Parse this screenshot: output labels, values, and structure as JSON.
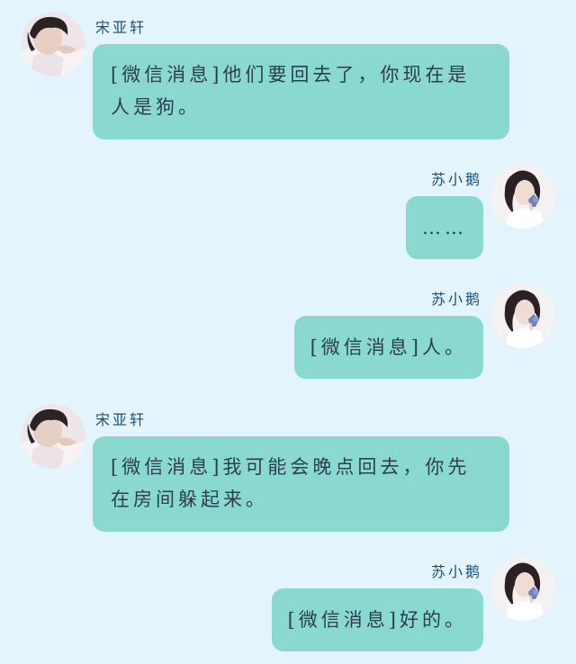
{
  "messages": [
    {
      "side": "left",
      "sender": "宋亚轩",
      "text": "[微信消息]他们要回去了，你现在是人是狗。",
      "avatar": "boy-avatar"
    },
    {
      "side": "right",
      "sender": "苏小鹅",
      "text": "……",
      "avatar": "girl-avatar"
    },
    {
      "side": "right",
      "sender": "苏小鹅",
      "text": "[微信消息]人。",
      "avatar": "girl-avatar"
    },
    {
      "side": "left",
      "sender": "宋亚轩",
      "text": "[微信消息]我可能会晚点回去，你先在房间躲起来。",
      "avatar": "boy-avatar"
    },
    {
      "side": "right",
      "sender": "苏小鹅",
      "text": "[微信消息]好的。",
      "avatar": "girl-avatar"
    }
  ],
  "colors": {
    "background": "#e3f4fc",
    "bubble": "#89d9d0",
    "name": "#1b4f72",
    "text": "#2c3e50"
  }
}
